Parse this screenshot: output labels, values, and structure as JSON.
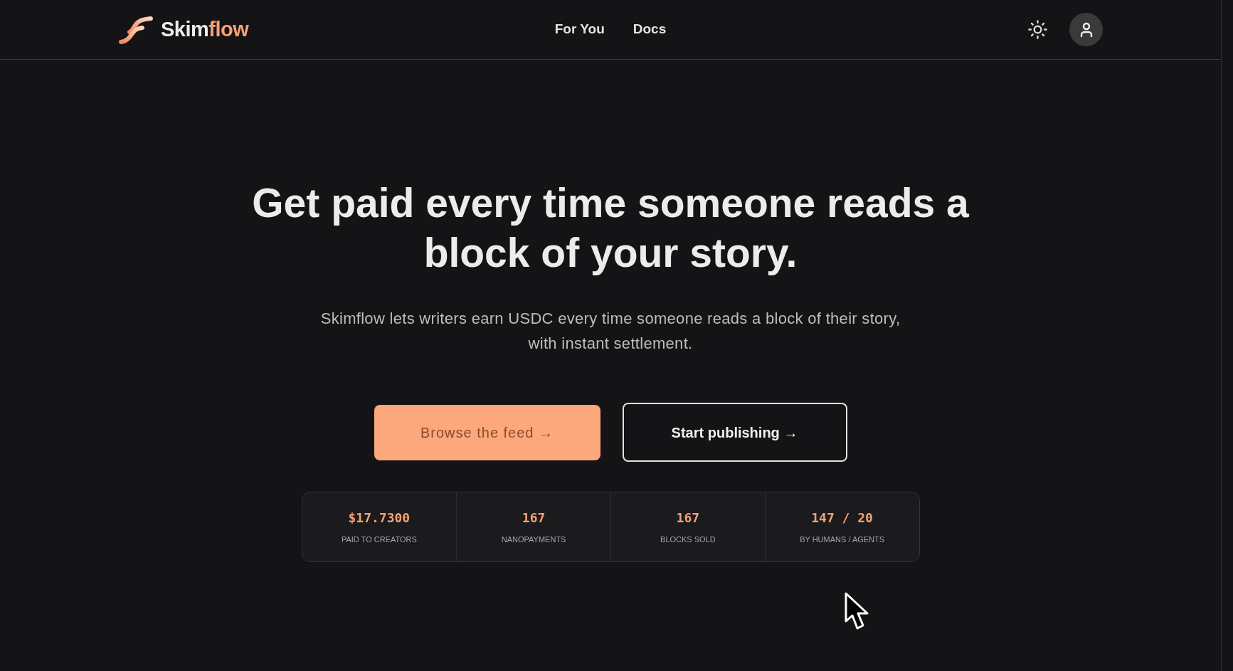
{
  "header": {
    "brand": [
      {
        "text": "Skim",
        "accent": false
      },
      {
        "text": "flow",
        "accent": true
      }
    ],
    "nav": [
      {
        "label": "For You"
      },
      {
        "label": "Docs"
      }
    ]
  },
  "hero": {
    "heading": "Get paid every time someone reads a block of your story.",
    "subtitle": "Skimflow lets writers earn USDC every time someone reads a block of their story, with instant settlement.",
    "buttons": [
      {
        "label": "Browse the feed →",
        "kind": "primary"
      },
      {
        "label": "Start publishing →",
        "kind": "outline"
      }
    ]
  },
  "stats": [
    {
      "value": "$17.7300",
      "label": "PAID TO CREATORS"
    },
    {
      "value": "167",
      "label": "NANOPAYMENTS"
    },
    {
      "value": "167",
      "label": "BLOCKS SOLD"
    },
    {
      "value": "147 / 20",
      "label": "BY HUMANS / AGENTS"
    }
  ]
}
